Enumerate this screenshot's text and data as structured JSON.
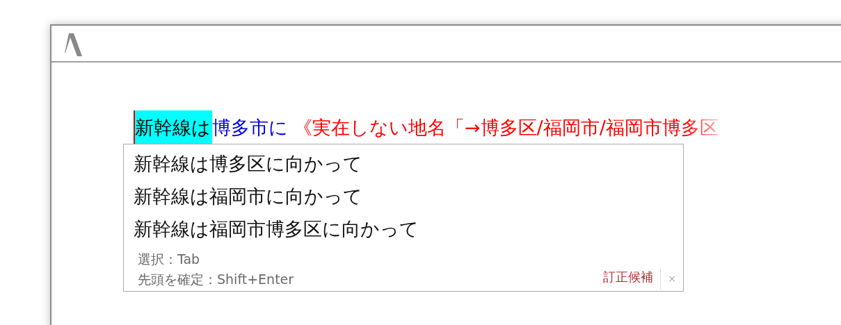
{
  "editor": {
    "segments": [
      {
        "text": "新幹線は",
        "kind": "highlight"
      },
      {
        "text": "博多市に",
        "kind": "flagged"
      },
      {
        "text": "《実在しない地名「→博多区/福岡市/福岡市博多区",
        "kind": "note"
      }
    ]
  },
  "suggestions": {
    "items": [
      "新幹線は博多区に向かって",
      "新幹線は福岡市に向かって",
      "新幹線は福岡市博多区に向かって"
    ],
    "hints": [
      "選択：Tab",
      "先頭を確定：Shift+Enter"
    ],
    "label": "訂正候補",
    "close": "×"
  }
}
